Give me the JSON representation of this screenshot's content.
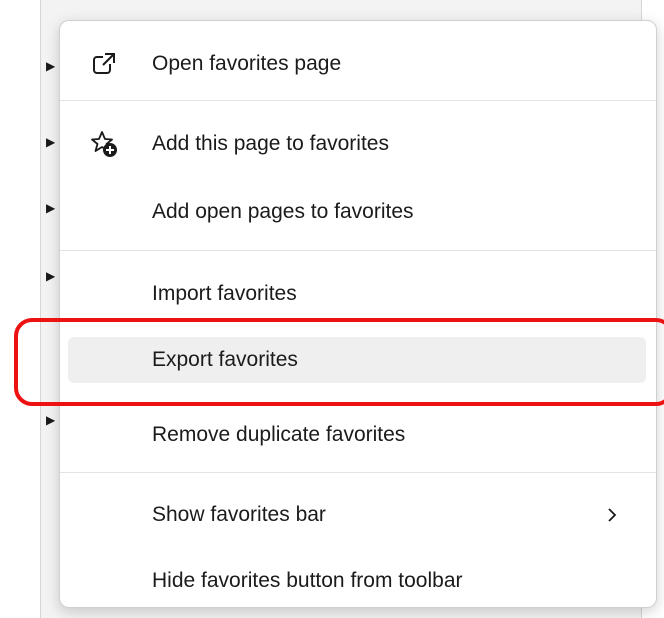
{
  "menu": {
    "items": [
      {
        "label": "Open favorites page",
        "icon": "open-external-icon"
      },
      {
        "label": "Add this page to favorites",
        "icon": "star-add-icon"
      },
      {
        "label": "Add open pages to favorites",
        "icon": ""
      },
      {
        "label": "Import favorites",
        "icon": ""
      },
      {
        "label": "Export favorites",
        "icon": "",
        "state": "hovered"
      },
      {
        "label": "Remove duplicate favorites",
        "icon": ""
      },
      {
        "label": "Show favorites bar",
        "icon": "",
        "submenu": true
      },
      {
        "label": "Hide favorites button from toolbar",
        "icon": ""
      }
    ]
  },
  "annotation": {
    "highlighted_item": "Export favorites",
    "color": "#ee1111"
  },
  "colors": {
    "menu_background": "#ffffff",
    "hover_background": "#efefef",
    "text": "#1b1b1b"
  }
}
